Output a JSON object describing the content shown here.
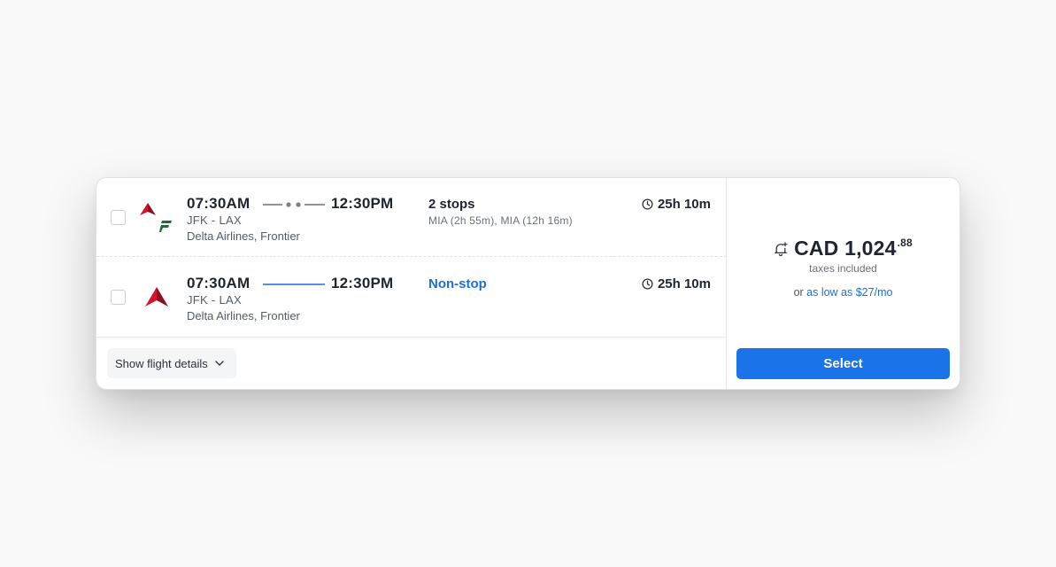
{
  "colors": {
    "accent": "#1a73e8",
    "link": "#1d6fd8",
    "delta_red": "#c8102e",
    "frontier_green": "#1f6b3a"
  },
  "flights": [
    {
      "departure_time": "07:30AM",
      "arrival_time": "12:30PM",
      "airports": "JFK - LAX",
      "airlines": "Delta Airlines, Frontier",
      "stops_label": "2 stops",
      "stops_detail": "MIA (2h 55m), MIA (12h 16m)",
      "duration": "25h 10m",
      "logos": [
        "delta-logo-icon",
        "frontier-logo-icon"
      ]
    },
    {
      "departure_time": "07:30AM",
      "arrival_time": "12:30PM",
      "airports": "JFK - LAX",
      "airlines": "Delta Airlines, Frontier",
      "stops_label": "Non-stop",
      "stops_detail": "",
      "duration": "25h 10m",
      "logos": [
        "delta-logo-icon"
      ]
    }
  ],
  "details_button": {
    "label": "Show flight details",
    "icon": "chevron-down-icon"
  },
  "price": {
    "currency": "CAD",
    "amount": "CAD 1,024",
    "cents": ".88",
    "taxes_label": "taxes included",
    "financing_prefix": "or ",
    "financing_link": "as low as $27/mo",
    "alert_icon": "bell-plus-icon"
  },
  "select_button": {
    "label": "Select"
  }
}
